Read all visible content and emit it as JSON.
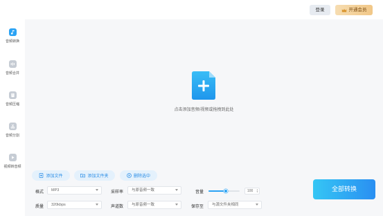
{
  "topbar": {
    "login_label": "登录",
    "vip_label": "开通会员"
  },
  "sidebar": {
    "items": [
      {
        "label": "音频转换",
        "icon": "music-note-icon",
        "active": true
      },
      {
        "label": "音频合并",
        "icon": "merge-icon",
        "active": false
      },
      {
        "label": "音频压缩",
        "icon": "compress-icon",
        "active": false
      },
      {
        "label": "音频分割",
        "icon": "scissors-icon",
        "active": false
      },
      {
        "label": "视频转音频",
        "icon": "video-icon",
        "active": false
      }
    ]
  },
  "dropzone": {
    "hint": "点击添加音频/视频或拖拽到此处"
  },
  "actions": {
    "add_file": "添加文件",
    "add_folder": "添加文件夹",
    "delete_selected": "删除选中"
  },
  "settings": {
    "format_label": "格式",
    "format_value": "MP3",
    "quality_label": "质量",
    "quality_value": "320kbps",
    "sample_rate_label": "采样率",
    "sample_rate_value": "与原音频一致",
    "channels_label": "声道数",
    "channels_value": "与原音频一致",
    "volume_label": "音量",
    "volume_value": "100",
    "volume_level": 0.55,
    "save_to_label": "保存至",
    "save_to_value": "与源文件夹相同"
  },
  "convert_all_label": "全部转换",
  "colors": {
    "accent": "#2ba3f4",
    "vip_gold": "#f1c787"
  }
}
